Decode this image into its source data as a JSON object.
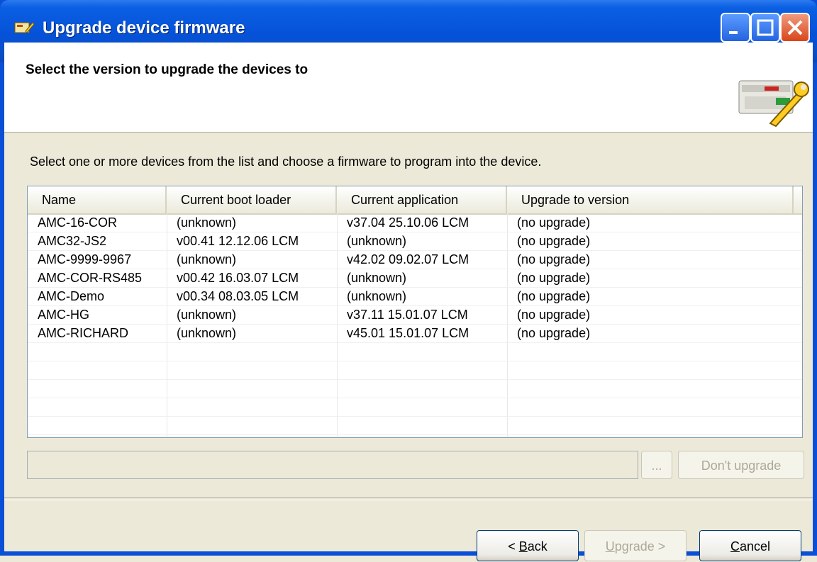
{
  "window": {
    "title": "Upgrade device firmware",
    "controls": [
      "minimize-icon",
      "maximize-icon",
      "close-icon"
    ]
  },
  "header": {
    "title": "Select the version to upgrade the devices to",
    "logo_icon": "device-wrench-icon"
  },
  "instruction": "Select one or more devices from the list and choose a firmware to program into the device.",
  "table": {
    "columns": [
      "Name",
      "Current boot loader",
      "Current application",
      "Upgrade to version"
    ],
    "rows": [
      [
        "AMC-16-COR",
        "(unknown)",
        "v37.04 25.10.06  LCM",
        "(no upgrade)"
      ],
      [
        "AMC32-JS2",
        "v00.41 12.12.06  LCM",
        "(unknown)",
        "(no upgrade)"
      ],
      [
        "AMC-9999-9967",
        "(unknown)",
        "v42.02 09.02.07  LCM",
        "(no upgrade)"
      ],
      [
        "AMC-COR-RS485",
        "v00.42 16.03.07  LCM",
        "(unknown)",
        "(no upgrade)"
      ],
      [
        "AMC-Demo",
        "v00.34 08.03.05  LCM",
        "(unknown)",
        "(no upgrade)"
      ],
      [
        "AMC-HG",
        "(unknown)",
        "v37.11 15.01.07  LCM",
        "(no upgrade)"
      ],
      [
        "AMC-RICHARD",
        "(unknown)",
        "v45.01 15.01.07  LCM",
        "(no upgrade)"
      ]
    ]
  },
  "version_field": {
    "value": ""
  },
  "buttons": {
    "browse": "...",
    "dont_upgrade": "Don't upgrade",
    "back_prefix": "< ",
    "back_mnemonic": "B",
    "back_rest": "ack",
    "upgrade_mnemonic": "U",
    "upgrade_rest": "pgrade >",
    "cancel_mnemonic": "C",
    "cancel_rest": "ancel"
  }
}
